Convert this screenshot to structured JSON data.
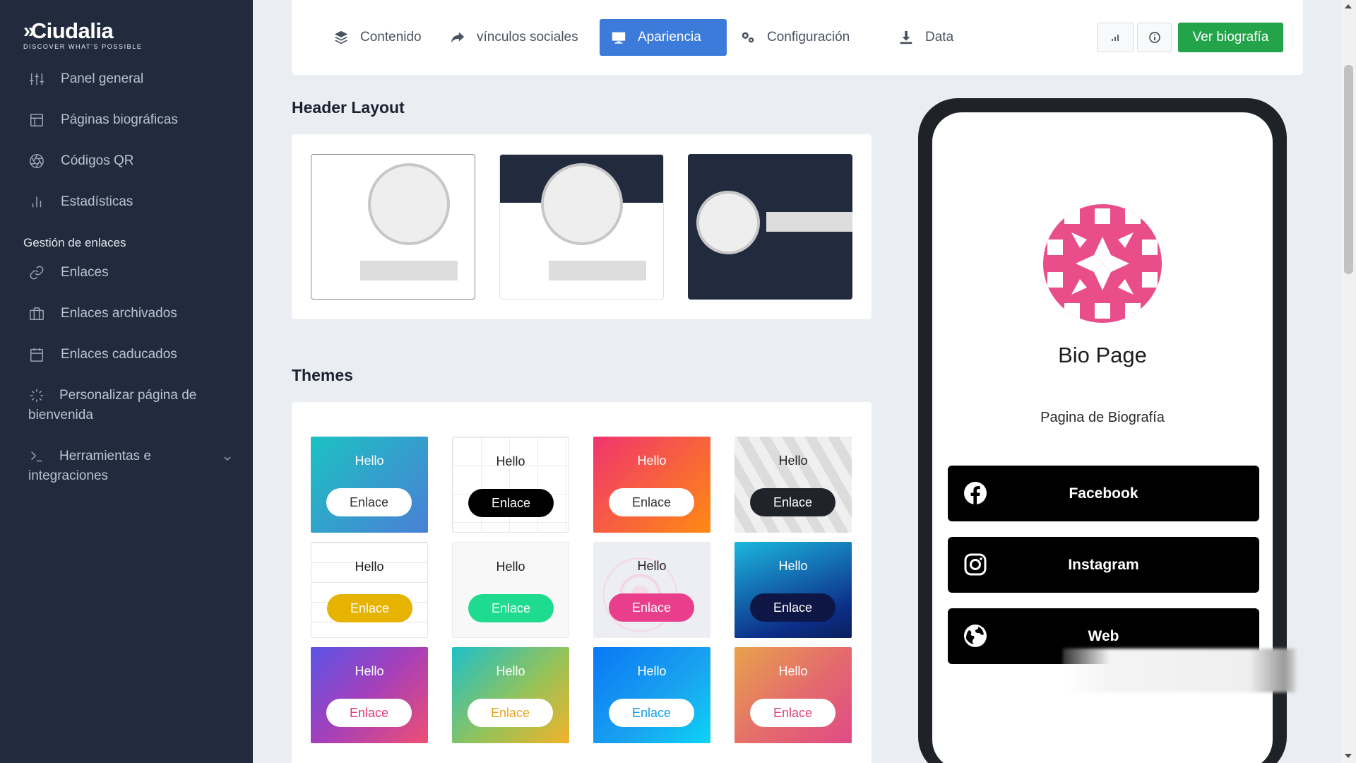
{
  "brand": {
    "name": "Ciudalia",
    "tagline": "DISCOVER WHAT'S POSSIBLE"
  },
  "sidebar": {
    "items": [
      {
        "label": "Panel general",
        "icon": "sliders-icon"
      },
      {
        "label": "Páginas biográficas",
        "icon": "layout-icon"
      },
      {
        "label": "Códigos QR",
        "icon": "aperture-icon"
      },
      {
        "label": "Estadísticas",
        "icon": "bar-chart-icon"
      }
    ],
    "section_label": "Gestión de enlaces",
    "link_items": [
      {
        "label": "Enlaces",
        "icon": "link-icon"
      },
      {
        "label": "Enlaces archivados",
        "icon": "briefcase-icon"
      },
      {
        "label": "Enlaces caducados",
        "icon": "calendar-icon"
      }
    ],
    "welcome_label": "Personalizar página de bienvenida",
    "welcome_icon": "loader-icon",
    "tools_label": "Herramientas e integraciones",
    "tools_icon": "terminal-icon"
  },
  "tabs": [
    {
      "label": "Contenido",
      "icon": "layers-icon"
    },
    {
      "label": "vínculos sociales",
      "icon": "share-icon"
    },
    {
      "label": "Apariencia",
      "icon": "monitor-icon",
      "active": true
    },
    {
      "label": "Configuración",
      "icon": "cogs-icon"
    },
    {
      "label": "Data",
      "icon": "download-icon"
    }
  ],
  "toolbar": {
    "stats_icon": "bar-chart-icon",
    "info_icon": "info-icon",
    "view_bio_label": "Ver biografía"
  },
  "header_layout": {
    "title": "Header Layout"
  },
  "themes": {
    "title": "Themes",
    "items": [
      {
        "hello": "Hello",
        "link": "Enlace"
      },
      {
        "hello": "Hello",
        "link": "Enlace"
      },
      {
        "hello": "Hello",
        "link": "Enlace"
      },
      {
        "hello": "Hello",
        "link": "Enlace"
      },
      {
        "hello": "Hello",
        "link": "Enlace"
      },
      {
        "hello": "Hello",
        "link": "Enlace"
      },
      {
        "hello": "Hello",
        "link": "Enlace"
      },
      {
        "hello": "Hello",
        "link": "Enlace"
      },
      {
        "hello": "Hello",
        "link": "Enlace"
      },
      {
        "hello": "Hello",
        "link": "Enlace"
      },
      {
        "hello": "Hello",
        "link": "Enlace"
      },
      {
        "hello": "Hello",
        "link": "Enlace"
      }
    ]
  },
  "preview": {
    "name": "Bio Page",
    "description": "Pagina de Biografía",
    "links": [
      {
        "label": "Facebook",
        "icon": "facebook-icon"
      },
      {
        "label": "Instagram",
        "icon": "instagram-icon"
      },
      {
        "label": "Web",
        "icon": "globe-icon"
      }
    ],
    "avatar_color": "#e94d8a"
  },
  "colors": {
    "sidebar_bg": "#212b3d",
    "accent": "#3d7bdb",
    "success": "#23a34a"
  }
}
